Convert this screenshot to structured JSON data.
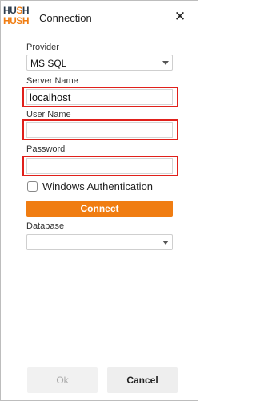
{
  "window": {
    "title": "Connection",
    "logo_line1": [
      "HU",
      "S",
      "H"
    ],
    "logo_line2": "HUSH",
    "close_glyph": "✕"
  },
  "form": {
    "provider_label": "Provider",
    "provider_value": "MS SQL",
    "server_label": "Server Name",
    "server_value": "localhost",
    "user_label": "User Name",
    "user_value": "",
    "password_label": "Password",
    "password_value": "",
    "windows_auth_label": "Windows Authentication",
    "windows_auth_checked": false,
    "connect_label": "Connect",
    "database_label": "Database",
    "database_value": ""
  },
  "footer": {
    "ok_label": "Ok",
    "cancel_label": "Cancel"
  },
  "colors": {
    "accent": "#f07d12",
    "highlight": "#e0201b",
    "logo_dark": "#2b3a4a"
  }
}
